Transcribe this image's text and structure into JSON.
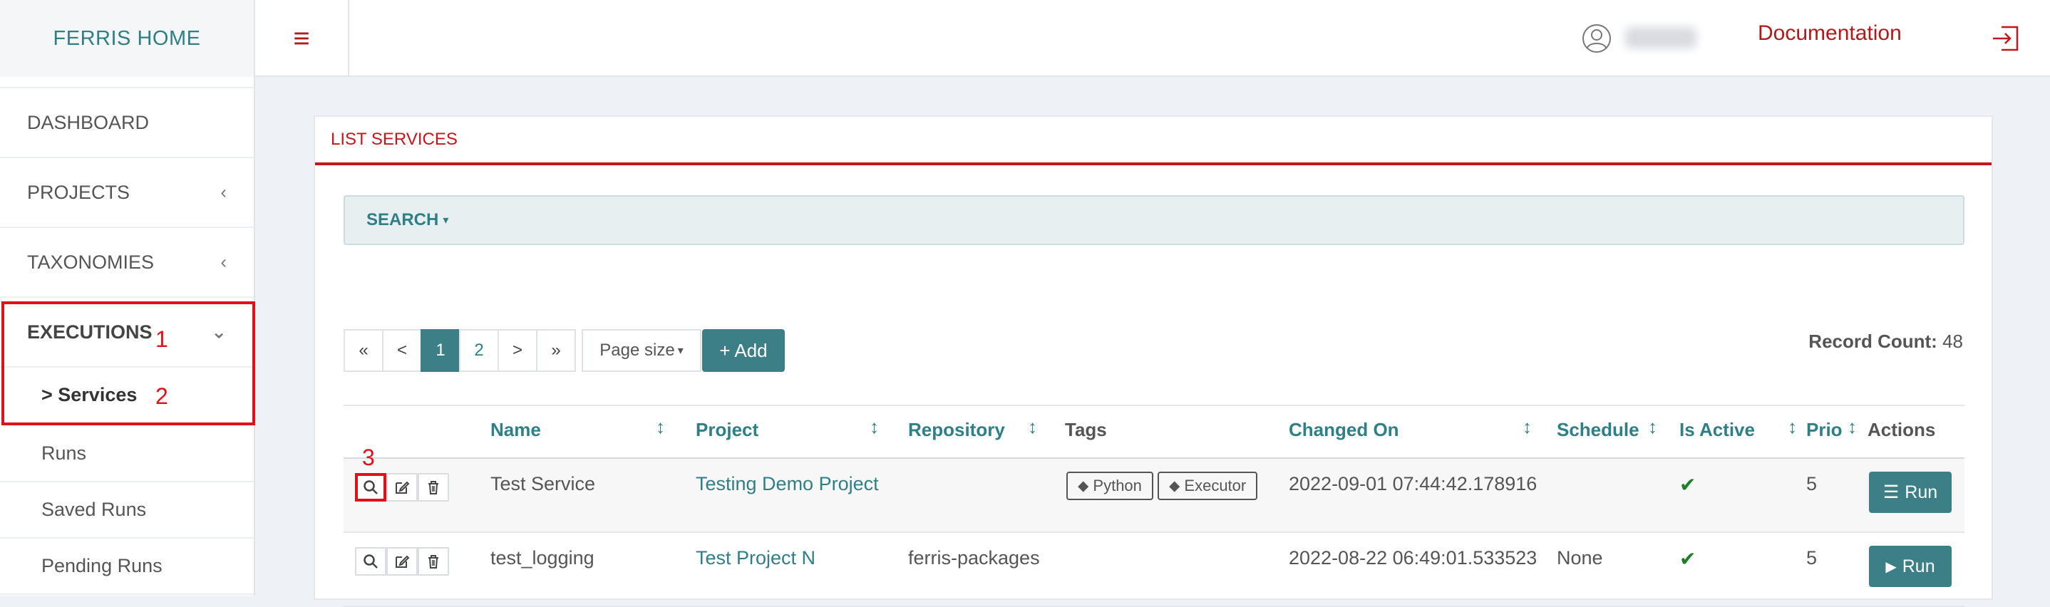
{
  "header": {
    "brand": "FERRIS HOME",
    "menu_icon": "hamburger-icon",
    "user_icon": "user-circle-icon",
    "documentation_link": "Documentation",
    "logout_icon": "logout-icon"
  },
  "sidebar": {
    "items": [
      {
        "label": "DASHBOARD"
      },
      {
        "label": "PROJECTS",
        "chevron": "‹"
      },
      {
        "label": "TAXONOMIES",
        "chevron": "‹"
      },
      {
        "label": "EXECUTIONS",
        "chevron": "⌄"
      }
    ],
    "sub_items": [
      {
        "label": "> Services"
      },
      {
        "label": "Runs"
      },
      {
        "label": "Saved Runs"
      },
      {
        "label": "Pending Runs"
      }
    ]
  },
  "annotations": [
    "1",
    "2",
    "3"
  ],
  "panel": {
    "title": "LIST SERVICES",
    "search_label": "SEARCH",
    "search_caret": "▾"
  },
  "pagination": {
    "first": "«",
    "prev": "<",
    "pages": [
      "1",
      "2"
    ],
    "next": ">",
    "last": "»",
    "page_size_label": "Page size",
    "page_size_caret": "▾",
    "add_label": "+ Add"
  },
  "record_count": {
    "label": "Record Count:",
    "value": "48"
  },
  "table": {
    "columns": [
      "Name",
      "Project",
      "Repository",
      "Tags",
      "Changed On",
      "Schedule",
      "Is Active",
      "Prio",
      "Actions"
    ],
    "sort_icon": "↕",
    "rows": [
      {
        "name": "Test Service",
        "project": "Testing Demo Project",
        "repository": "",
        "tags": [
          "Python",
          "Executor"
        ],
        "changed_on": "2022-09-01 07:44:42.178916",
        "schedule": "",
        "is_active": "✔",
        "prio": "5",
        "action": "Run",
        "action_icon": "list-icon"
      },
      {
        "name": "test_logging",
        "project": "Test Project N",
        "repository": "ferris-packages",
        "tags": [],
        "changed_on": "2022-08-22 06:49:01.533523",
        "schedule": "None",
        "is_active": "✔",
        "prio": "5",
        "action": "Run",
        "action_icon": "play-icon"
      }
    ]
  },
  "colors": {
    "accent": "#c4161c",
    "teal": "#3d7f86",
    "highlight": "#e1111a"
  }
}
